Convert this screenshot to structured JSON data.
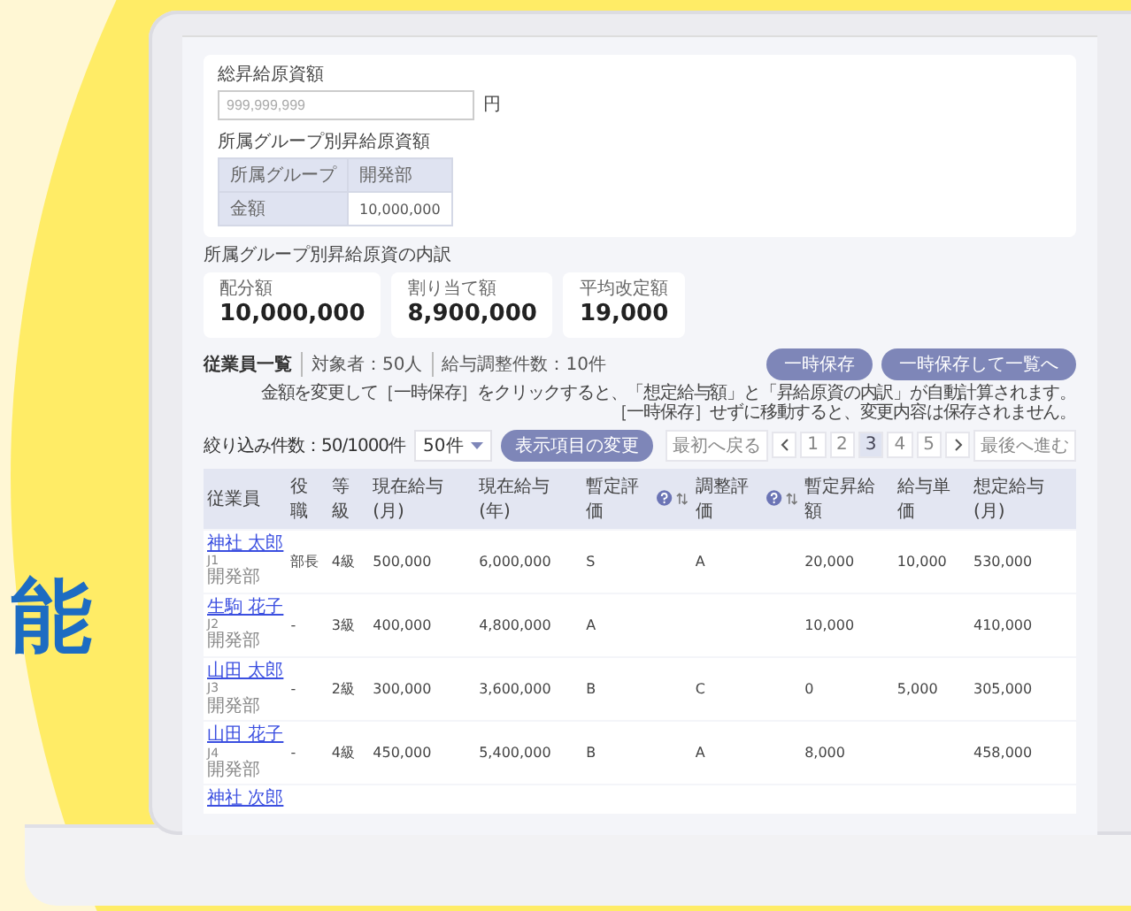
{
  "headline": "能",
  "budget": {
    "label": "総昇給原資額",
    "placeholder": "999,999,999",
    "unit": "円",
    "group_label": "所属グループ別昇給原資額",
    "group_table": [
      [
        "所属グループ",
        "開発部"
      ],
      [
        "金額",
        "10,000,000"
      ]
    ]
  },
  "breakdown": {
    "label": "所属グループ別昇給原資の内訳",
    "cards": [
      {
        "label": "配分額",
        "value": "10,000,000"
      },
      {
        "label": "割り当て額",
        "value": "8,900,000"
      },
      {
        "label": "平均改定額",
        "value": "19,000"
      }
    ]
  },
  "employees": {
    "title": "従業員一覧",
    "target": "対象者：50人",
    "adjust": "給与調整件数：10件",
    "buttons": [
      "一時保存",
      "一時保存して一覧へ"
    ],
    "notes": [
      "金額を変更して［一時保存］をクリックすると、「想定給与額」と「昇給原資の内訳」が自動計算されます。",
      "［一時保存］せずに移動すると、変更内容は保存されません。"
    ]
  },
  "filter": {
    "count": "絞り込み件数：50/1000件",
    "per_page": "50件",
    "columns_button": "表示項目の変更"
  },
  "pagination": {
    "first": "最初へ戻る",
    "last": "最後へ進む",
    "pages": [
      {
        "label": "1",
        "selected": false
      },
      {
        "label": "2",
        "selected": false
      },
      {
        "label": "3",
        "selected": true
      },
      {
        "label": "4",
        "selected": false
      },
      {
        "label": "5",
        "selected": false
      }
    ]
  },
  "table": {
    "columns": [
      {
        "label": "従業員",
        "help": false,
        "sortable": false
      },
      {
        "label": "役職",
        "help": false,
        "sortable": false
      },
      {
        "label": "等級",
        "help": false,
        "sortable": false
      },
      {
        "label": "現在給与(月)",
        "help": false,
        "sortable": false
      },
      {
        "label": "現在給与(年)",
        "help": false,
        "sortable": false
      },
      {
        "label": "暫定評価",
        "help": true,
        "sortable": true
      },
      {
        "label": "調整評価",
        "help": true,
        "sortable": true
      },
      {
        "label": "暫定昇給額",
        "help": false,
        "sortable": false
      },
      {
        "label": "給与単価",
        "help": false,
        "sortable": false
      },
      {
        "label": "想定給与(月)",
        "help": false,
        "sortable": false
      }
    ],
    "rows": [
      {
        "name": "神社 太郎",
        "code": "J1",
        "dept": "開発部",
        "cells": [
          "部長",
          "4級",
          "500,000",
          "6,000,000",
          "S",
          "A",
          "20,000",
          "10,000",
          "530,000"
        ]
      },
      {
        "name": "生駒 花子",
        "code": "J2",
        "dept": "開発部",
        "cells": [
          "-",
          "3級",
          "400,000",
          "4,800,000",
          "A",
          null,
          "10,000",
          null,
          "410,000"
        ]
      },
      {
        "name": "山田 太郎",
        "code": "J3",
        "dept": "開発部",
        "cells": [
          "-",
          "2級",
          "300,000",
          "3,600,000",
          "B",
          "C",
          "0",
          "5,000",
          "305,000"
        ]
      },
      {
        "name": "山田 花子",
        "code": "J4",
        "dept": "開発部",
        "cells": [
          "-",
          "4級",
          "450,000",
          "5,400,000",
          "B",
          "A",
          "8,000",
          null,
          "458,000"
        ]
      },
      {
        "name": "神社 次郎"
      }
    ]
  }
}
